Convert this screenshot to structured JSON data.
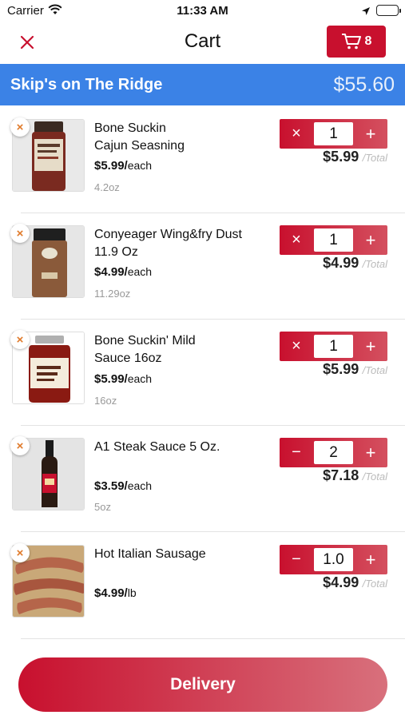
{
  "status": {
    "carrier": "Carrier",
    "time": "11:33 AM"
  },
  "header": {
    "title": "Cart",
    "cart_count": "8"
  },
  "store": {
    "name": "Skip's on The Ridge",
    "total": "$55.60"
  },
  "items": [
    {
      "name": "Bone Suckin\nCajun Seasning",
      "price": "$5.99/",
      "unit": "each",
      "size": "4.2oz",
      "qty": "1",
      "minus_symbol": "×",
      "plus_symbol": "+",
      "line_total": "$5.99",
      "total_label": "/Total",
      "thumb": "bone-suckin-cajun-seasoning-photo"
    },
    {
      "name": "Conyeager Wing&fry Dust\n11.9 Oz",
      "price": "$4.99/",
      "unit": "each",
      "size": "11.29oz",
      "qty": "1",
      "minus_symbol": "×",
      "plus_symbol": "+",
      "line_total": "$4.99",
      "total_label": "/Total",
      "thumb": "wing-fry-dust-photo"
    },
    {
      "name": "Bone Suckin' Mild\nSauce 16oz",
      "price": "$5.99/",
      "unit": "each",
      "size": "16oz",
      "qty": "1",
      "minus_symbol": "×",
      "plus_symbol": "+",
      "line_total": "$5.99",
      "total_label": "/Total",
      "thumb": "bone-suckin-sauce-photo"
    },
    {
      "name": "A1 Steak Sauce 5 Oz.",
      "price": "$3.59/",
      "unit": "each",
      "size": "5oz",
      "qty": "2",
      "minus_symbol": "−",
      "plus_symbol": "+",
      "line_total": "$7.18",
      "total_label": "/Total",
      "thumb": "a1-steak-sauce-photo"
    },
    {
      "name": "Hot Italian Sausage",
      "price": "$4.99/",
      "unit": "lb",
      "size": "",
      "qty": "1.0",
      "minus_symbol": "−",
      "plus_symbol": "+",
      "line_total": "$4.99",
      "total_label": "/Total",
      "thumb": "hot-italian-sausage-photo"
    }
  ],
  "footer": {
    "delivery_label": "Delivery"
  },
  "colors": {
    "accent": "#c8102e",
    "store_bar": "#3b82e6",
    "remove_icon": "#e07a2a"
  }
}
